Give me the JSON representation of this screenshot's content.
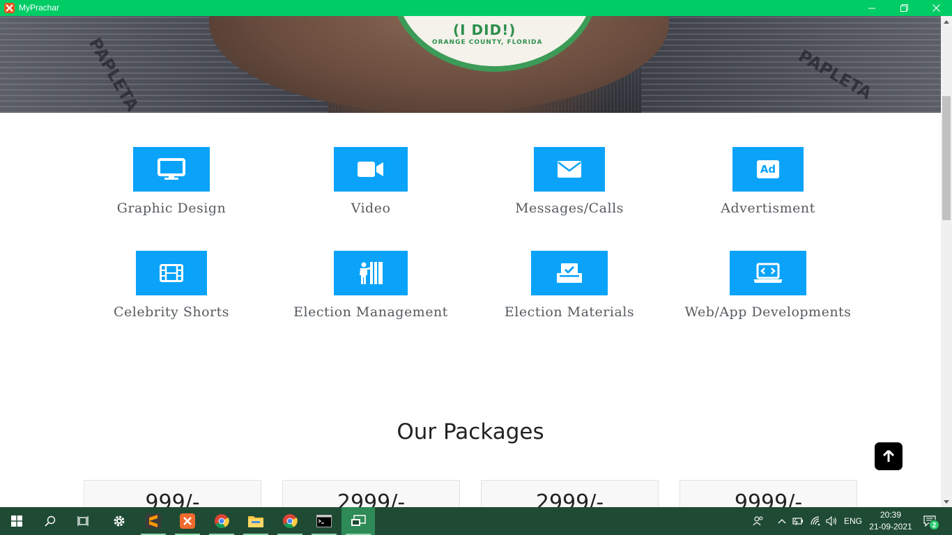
{
  "window": {
    "title": "MyPrachar"
  },
  "hero": {
    "sticker_text": "(I DID!)",
    "sticker_sub": "ORANGE COUNTY, FLORIDA",
    "paper_word_left": "PAPLETA",
    "paper_word_right": "PAPLETA"
  },
  "services": [
    {
      "label": "Graphic Design",
      "icon": "monitor-icon"
    },
    {
      "label": "Video",
      "icon": "video-camera-icon"
    },
    {
      "label": "Messages/Calls",
      "icon": "envelope-icon"
    },
    {
      "label": "Advertisment",
      "icon": "ad-icon",
      "icon_text": "Ad"
    },
    {
      "label": "Celebrity Shorts",
      "icon": "film-icon"
    },
    {
      "label": "Election Management",
      "icon": "voting-booth-icon"
    },
    {
      "label": "Election Materials",
      "icon": "vote-box-icon"
    },
    {
      "label": "Web/App Developments",
      "icon": "laptop-code-icon"
    }
  ],
  "packages": {
    "title": "Our Packages",
    "items": [
      {
        "price": "999/-"
      },
      {
        "price": "2999/-"
      },
      {
        "price": "2999/-"
      },
      {
        "price": "9999/-"
      }
    ]
  },
  "taskbar": {
    "apps": [
      "start",
      "search",
      "task-view",
      "settings",
      "sublime-text",
      "xampp",
      "chrome",
      "file-explorer",
      "chrome",
      "command-prompt",
      "myprachar"
    ],
    "language": "ENG",
    "time": "20:39",
    "date": "21-09-2021",
    "notification_count": "2"
  },
  "colors": {
    "titlebar": "#00cc66",
    "accent": "#0aa3f9",
    "taskbar": "#1f4b34"
  }
}
